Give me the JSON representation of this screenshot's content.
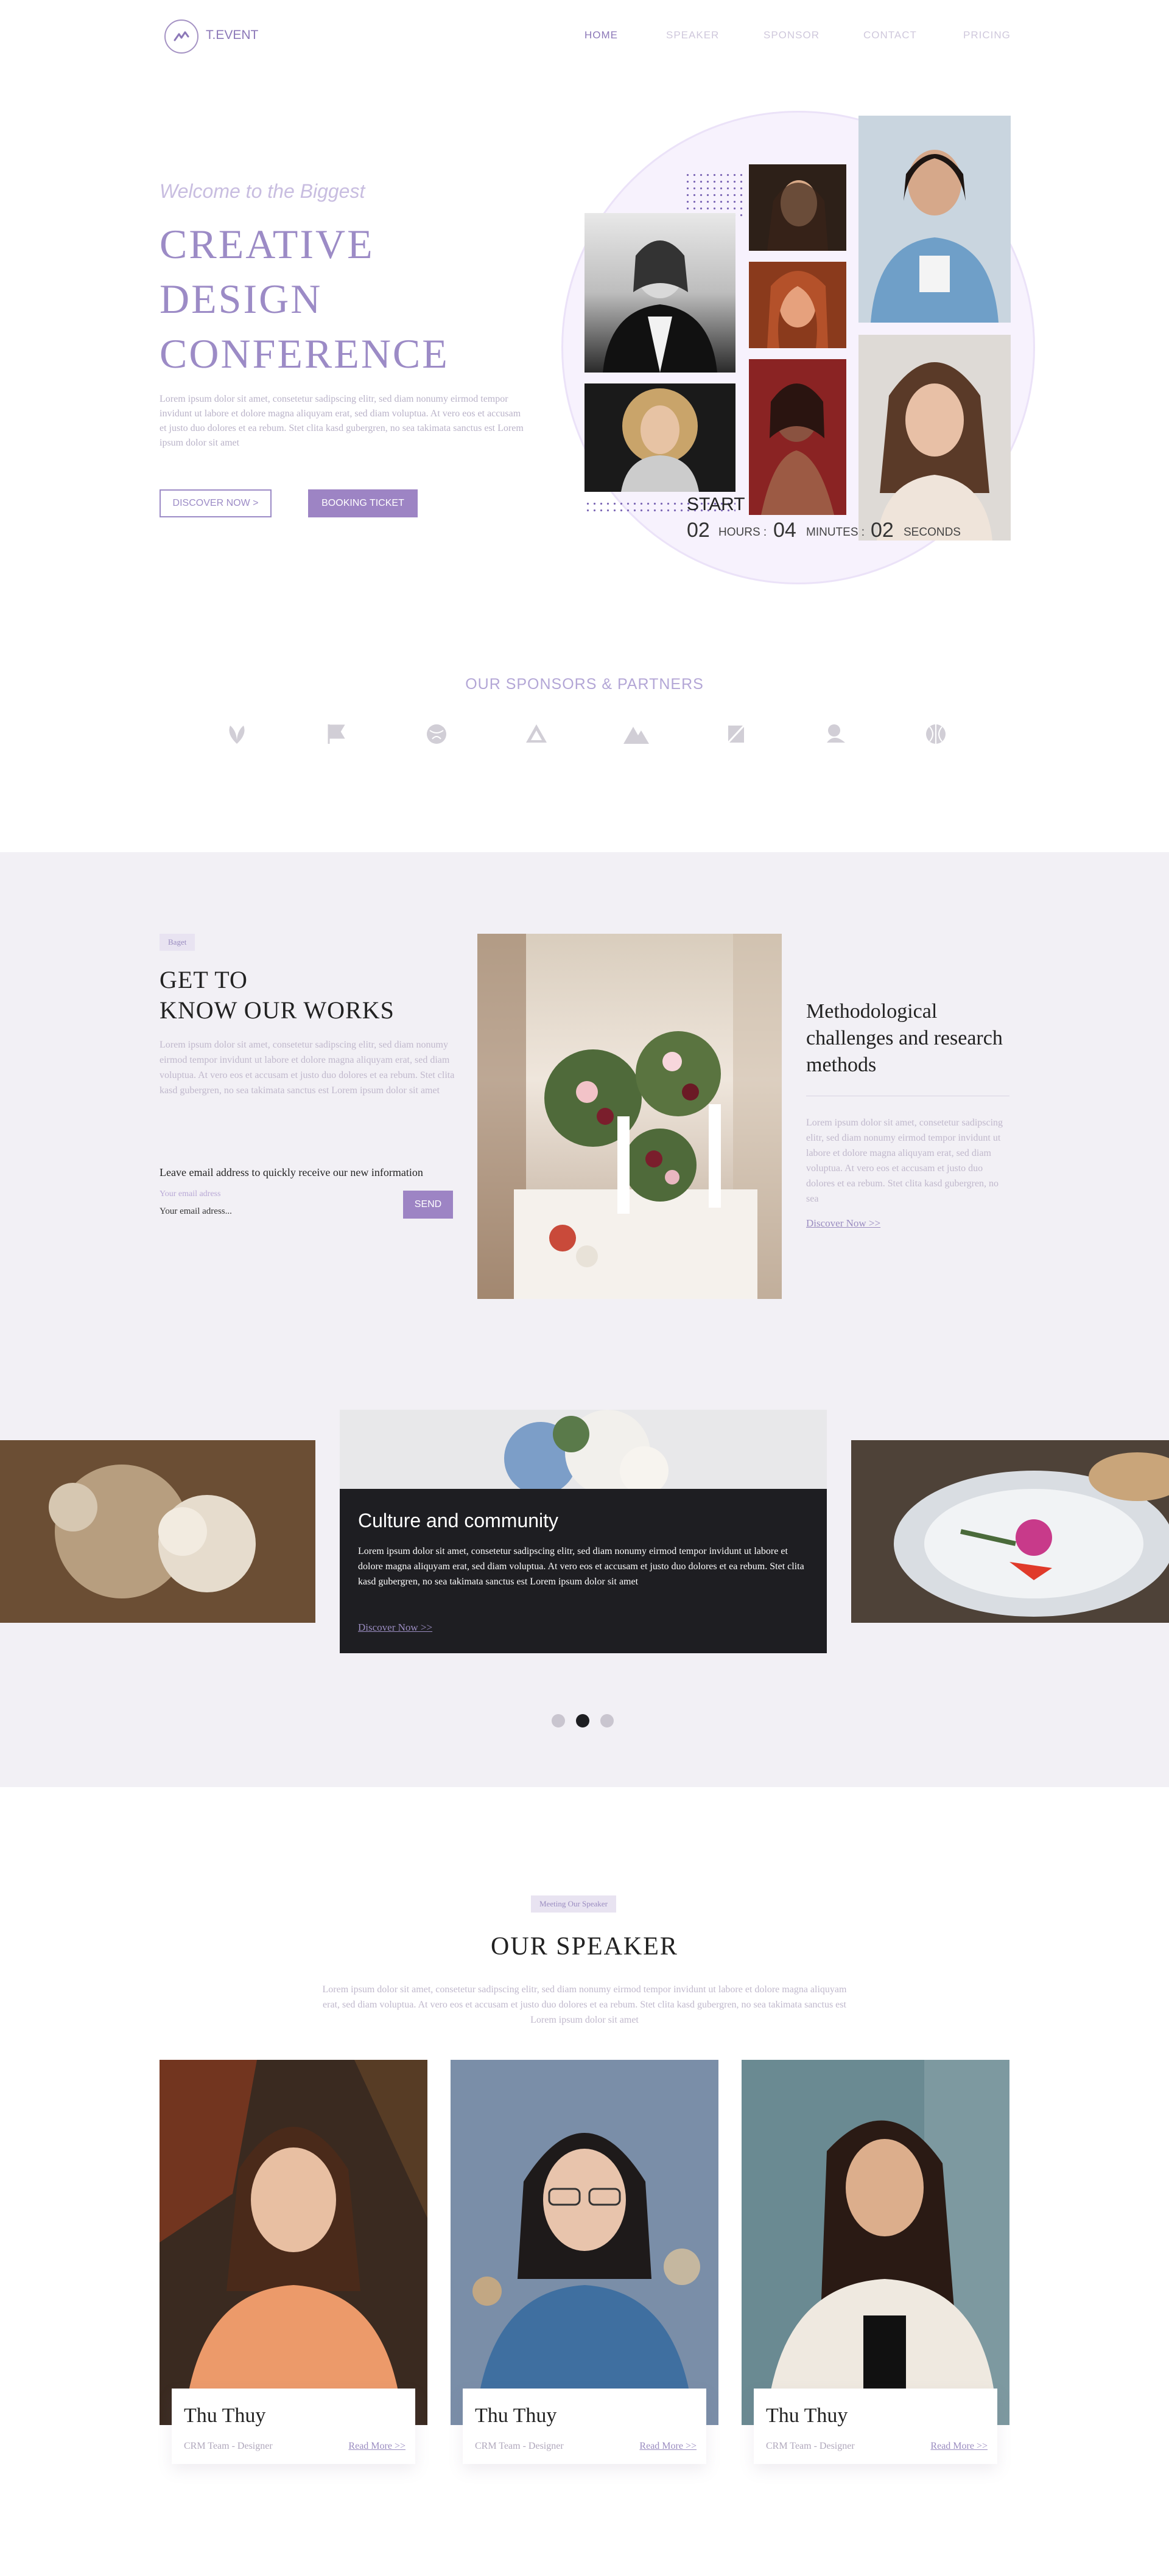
{
  "header": {
    "logo_text": "T.EVENT",
    "nav": [
      "HOME",
      "SPEAKER",
      "SPONSOR",
      "CONTACT",
      "PRICING"
    ]
  },
  "hero": {
    "pre_title": "Welcome to the Biggest",
    "title_lines": [
      "CREATIVE",
      "DESIGN",
      "CONFERENCE"
    ],
    "paragraph": "Lorem ipsum dolor sit amet, consetetur sadipscing elitr, sed diam nonumy eirmod tempor invidunt ut labore et dolore magna aliquyam erat, sed diam voluptua. At vero eos et accusam et justo duo dolores et ea rebum. Stet clita kasd gubergren, no sea takimata sanctus est Lorem ipsum dolor sit amet",
    "btn_discover": "DISCOVER NOW >",
    "btn_booking": "BOOKING TICKET",
    "countdown": {
      "start": "START",
      "hours": "02",
      "hours_label": "HOURS :",
      "minutes": "04",
      "minutes_label": "MINUTES :",
      "seconds": "02",
      "seconds_label": "SECONDS"
    }
  },
  "sponsors": {
    "title": "OUR SPONSORS & PARTNERS",
    "logos": [
      "leaf-logo-icon",
      "flag-logo-icon",
      "globe-logo-icon",
      "triangle-logo-icon",
      "mountain-logo-icon",
      "square-logo-icon",
      "drop-logo-icon",
      "shell-logo-icon"
    ]
  },
  "works": {
    "tag": "Baget",
    "title_lines": [
      "GET TO",
      "KNOW OUR WORKS"
    ],
    "paragraph": "Lorem ipsum dolor sit amet, consetetur sadipscing elitr, sed diam nonumy eirmod tempor invidunt ut labore et dolore magna aliquyam erat, sed diam voluptua. At vero eos et accusam et justo duo dolores et ea rebum. Stet clita kasd gubergren, no sea takimata sanctus est Lorem ipsum dolor sit amet",
    "email_title": "Leave email address to quickly receive our  new information",
    "email_label": "Your email adress",
    "email_value": "Your email adress...",
    "send": "SEND",
    "side_title": "Methodological challenges and research methods",
    "side_paragraph": "Lorem ipsum dolor sit amet, consetetur sadipscing elitr, sed diam nonumy eirmod tempor invidunt ut labore et dolore magna aliquyam erat, sed diam voluptua. At vero eos et accusam et justo duo dolores et ea rebum. Stet clita kasd gubergren, no sea",
    "side_link": "Discover Now >>"
  },
  "carousel": {
    "card_title": "Culture and community",
    "card_paragraph": "Lorem ipsum dolor sit amet, consetetur sadipscing elitr, sed diam nonumy eirmod tempor invidunt ut labore et dolore magna aliquyam erat, sed diam voluptua. At vero eos et accusam et justo duo dolores et ea rebum. Stet clita kasd gubergren, no sea takimata sanctus est Lorem ipsum dolor sit amet",
    "card_link": "Discover Now >>",
    "active_slide": 2
  },
  "speakers": {
    "tag": "Meeting Our Speaker",
    "title": "OUR SPEAKER",
    "paragraph": "Lorem ipsum dolor sit amet, consetetur sadipscing elitr, sed diam nonumy eirmod tempor invidunt ut labore et dolore magna aliquyam erat, sed diam voluptua. At vero eos et accusam et justo duo dolores et ea rebum. Stet clita kasd gubergren, no sea takimata sanctus est Lorem ipsum dolor sit amet",
    "cards": [
      {
        "name": "Thu Thuy",
        "role": "CRM Team - Designer",
        "link": "Read More >>"
      },
      {
        "name": "Thu Thuy",
        "role": "CRM Team - Designer",
        "link": "Read More >>"
      },
      {
        "name": "Thu Thuy",
        "role": "CRM Team - Designer",
        "link": "Read More >>"
      }
    ]
  },
  "colors": {
    "accent": "#9d84c4",
    "accent_light": "#f2f0f5",
    "dark_card": "#1e1e22"
  }
}
